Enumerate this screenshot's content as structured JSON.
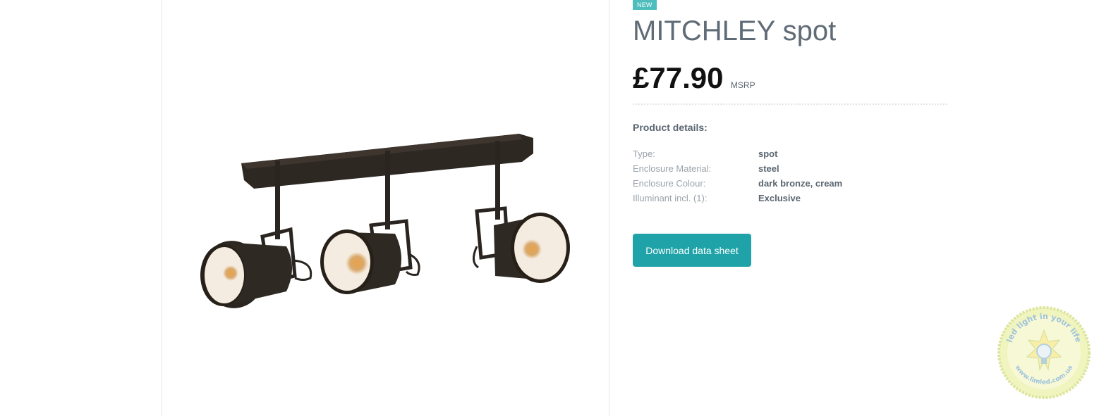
{
  "product": {
    "badge": "NEW",
    "title": "MITCHLEY spot",
    "price": "£77.90",
    "price_note": "MSRP",
    "details_heading": "Product details:",
    "specs": [
      {
        "label": "Type:",
        "value": "spot"
      },
      {
        "label": "Enclosure Material:",
        "value": "steel"
      },
      {
        "label": "Enclosure Colour:",
        "value": "dark bronze, cream"
      },
      {
        "label": "Illuminant incl. (1):",
        "value": "Exclusive"
      }
    ],
    "download_label": "Download data sheet"
  },
  "watermark": {
    "text": "led light in your life",
    "url": "www.limled.com.ua"
  },
  "colors": {
    "accent": "#1fa3a8",
    "badge": "#4dbdbd",
    "lamp_body": "#2a2520",
    "lamp_inner": "#f4ece0"
  }
}
